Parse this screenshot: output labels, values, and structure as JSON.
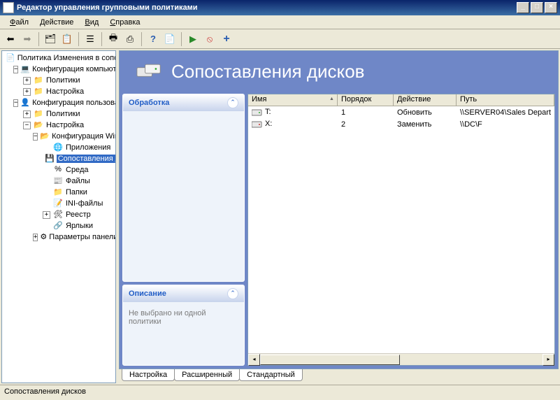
{
  "window": {
    "title": "Редактор управления групповыми политиками"
  },
  "menu": {
    "file": "Файл",
    "action": "Действие",
    "view": "Вид",
    "help": "Справка"
  },
  "tree": {
    "root": "Политика Изменения в сопоставл",
    "compConfig": "Конфигурация компьютера",
    "policies": "Политики",
    "settings": "Настройка",
    "userConfig": "Конфигурация пользователя",
    "winConfig": "Конфигурация Windov",
    "apps": "Приложения",
    "driveMaps": "Сопоставления ди",
    "env": "Среда",
    "files": "Файлы",
    "folders": "Папки",
    "ini": "INI-файлы",
    "registry": "Реестр",
    "shortcuts": "Ярлыки",
    "cpParams": "Параметры панели уг"
  },
  "header": {
    "title": "Сопоставления дисков"
  },
  "panels": {
    "processing": "Обработка",
    "description": "Описание",
    "descText": "Не выбрано ни одной политики"
  },
  "columns": {
    "name": "Имя",
    "order": "Порядок",
    "action": "Действие",
    "path": "Путь"
  },
  "rows": [
    {
      "icon": "green",
      "name": "T:",
      "order": "1",
      "action": "Обновить",
      "path": "\\\\SERVER04\\Sales Depart"
    },
    {
      "icon": "red",
      "name": "X:",
      "order": "2",
      "action": "Заменить",
      "path": "\\\\DC\\F"
    }
  ],
  "tabs": {
    "settings": "Настройка",
    "extended": "Расширенный",
    "standard": "Стандартный"
  },
  "status": "Сопоставления дисков"
}
